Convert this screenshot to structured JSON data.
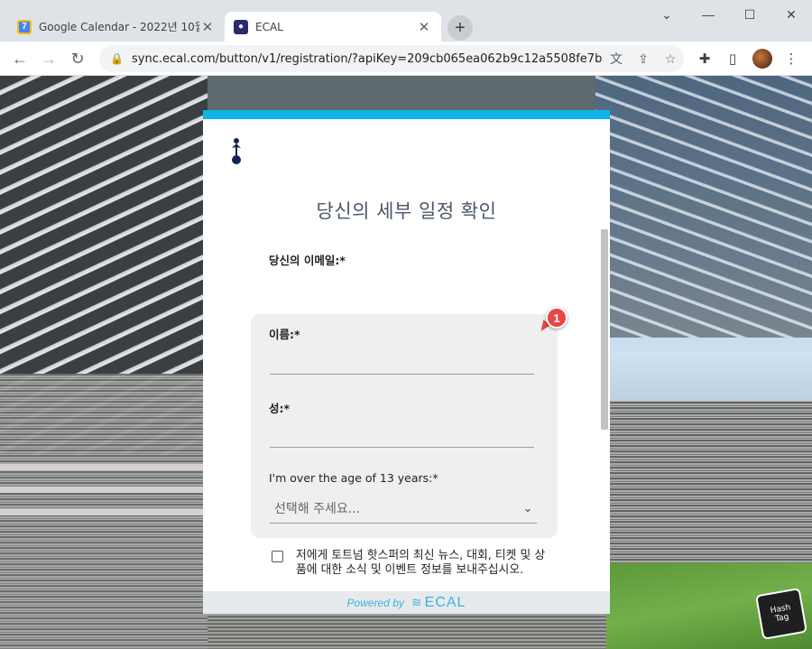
{
  "browser": {
    "tabs": [
      {
        "title": "Google Calendar - 2022년 10월",
        "favicon": "google-calendar-icon",
        "favicon_text": "7",
        "active": false
      },
      {
        "title": "ECAL",
        "favicon": "ecal-icon",
        "active": true
      }
    ],
    "new_tab": "+",
    "url": "sync.ecal.com/button/v1/registration/?apiKey=209cb065ea062b9c12a5508fe7b...",
    "window_controls": {
      "collapse": "⌄",
      "minimize": "—",
      "maximize": "☐",
      "close": "✕"
    }
  },
  "form": {
    "title": "당신의 세부 일정 확인",
    "email_label": "당신의 이메일:*",
    "first_name_label": "이름:*",
    "last_name_label": "성:*",
    "age_label": "I'm over the age of 13 years:*",
    "age_select_value": "선택해 주세요...",
    "consent_text": "저에게 토트넘 핫스퍼의 최신 뉴스, 대회, 티켓 및 상품에 대한 소식 및 이벤트 정보를 보내주십시오.",
    "consent_checked": false
  },
  "footer": {
    "powered_by": "Powered by",
    "brand": "ECAL"
  },
  "annotation": {
    "badge_number": "1"
  },
  "watermark": {
    "line1": "Hash",
    "line2": "Tag"
  },
  "colors": {
    "accent": "#10b4e6",
    "title_text": "#4a5668",
    "badge": "#e84545"
  }
}
